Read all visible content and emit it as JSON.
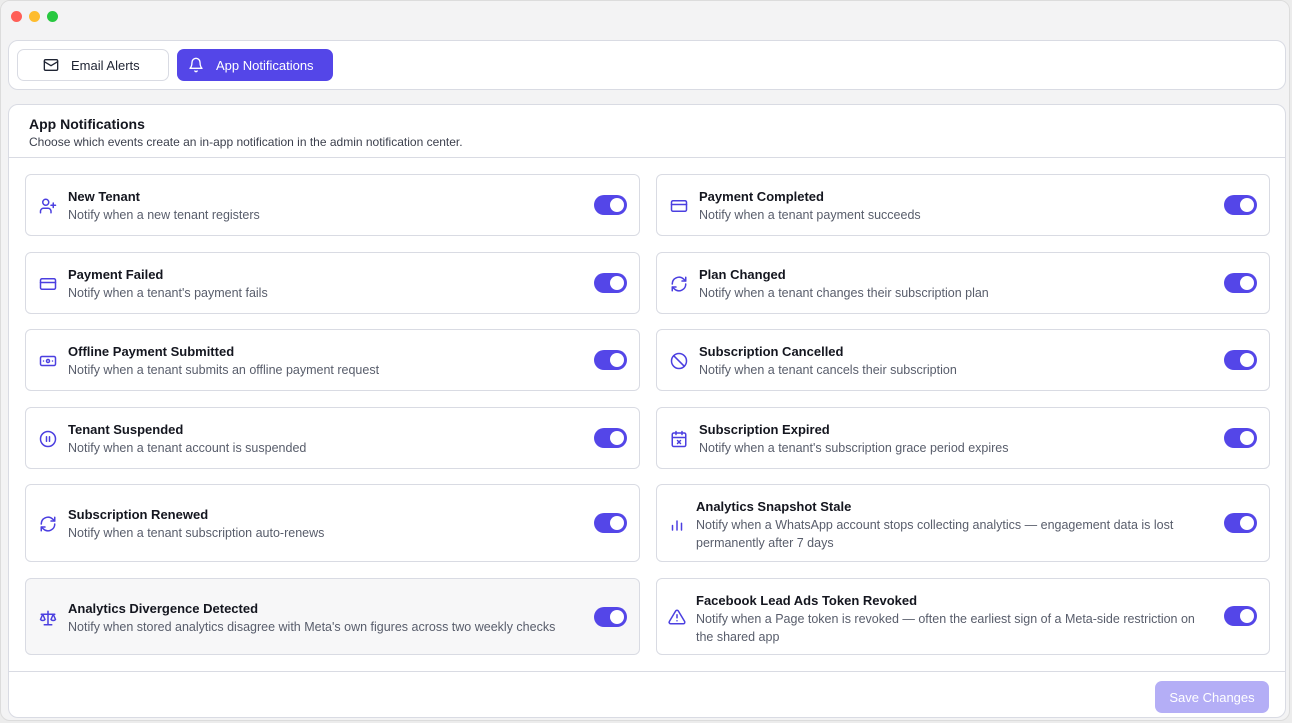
{
  "tabs": {
    "email_label": "Email Alerts",
    "app_label": "App Notifications"
  },
  "panel": {
    "title": "App Notifications",
    "subtitle": "Choose which events create an in-app notification in the admin notification center."
  },
  "notifications": [
    {
      "title": "New Tenant",
      "desc": "Notify when a new tenant registers",
      "icon": "user-plus-icon",
      "enabled": true
    },
    {
      "title": "Payment Completed",
      "desc": "Notify when a tenant payment succeeds",
      "icon": "credit-card-icon",
      "enabled": true
    },
    {
      "title": "Payment Failed",
      "desc": "Notify when a tenant's payment fails",
      "icon": "credit-card-icon",
      "enabled": true
    },
    {
      "title": "Plan Changed",
      "desc": "Notify when a tenant changes their subscription plan",
      "icon": "refresh-icon",
      "enabled": true
    },
    {
      "title": "Offline Payment Submitted",
      "desc": "Notify when a tenant submits an offline payment request",
      "icon": "banknote-icon",
      "enabled": true
    },
    {
      "title": "Subscription Cancelled",
      "desc": "Notify when a tenant cancels their subscription",
      "icon": "ban-icon",
      "enabled": true
    },
    {
      "title": "Tenant Suspended",
      "desc": "Notify when a tenant account is suspended",
      "icon": "pause-circle-icon",
      "enabled": true
    },
    {
      "title": "Subscription Expired",
      "desc": "Notify when a tenant's subscription grace period expires",
      "icon": "calendar-x-icon",
      "enabled": true
    },
    {
      "title": "Subscription Renewed",
      "desc": "Notify when a tenant subscription auto-renews",
      "icon": "refresh-icon",
      "enabled": true
    },
    {
      "title": "Analytics Snapshot Stale",
      "desc": "Notify when a WhatsApp account stops collecting analytics — engagement data is lost permanently after 7 days",
      "icon": "bar-chart-icon",
      "enabled": true
    },
    {
      "title": "Analytics Divergence Detected",
      "desc": "Notify when stored analytics disagree with Meta's own figures across two weekly checks",
      "icon": "scale-icon",
      "enabled": true
    },
    {
      "title": "Facebook Lead Ads Token Revoked",
      "desc": "Notify when a Page token is revoked — often the earliest sign of a Meta-side restriction on the shared app",
      "icon": "alert-triangle-icon",
      "enabled": true
    }
  ],
  "footer": {
    "save_label": "Save Changes"
  },
  "colors": {
    "accent": "#5446e8",
    "accent_disabled": "#b4aef6",
    "icon": "#4b3fe0"
  }
}
